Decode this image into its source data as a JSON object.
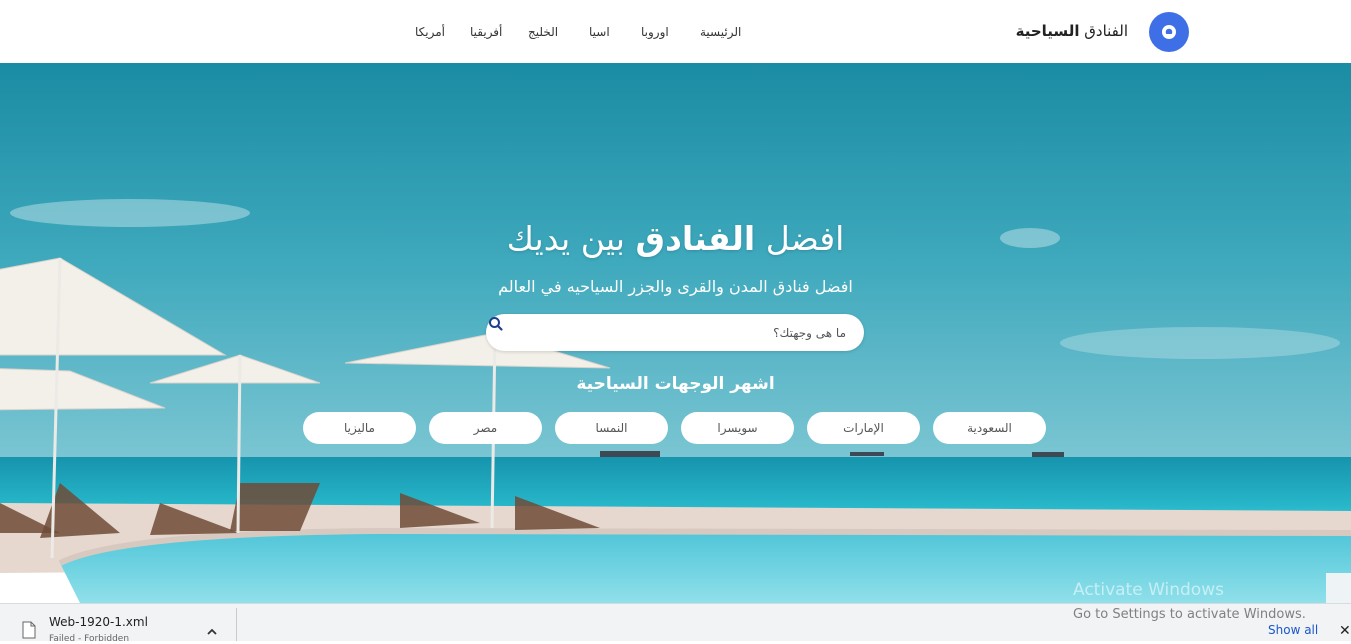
{
  "brand": {
    "title_light": "الفنادق",
    "title_bold": "السياحية",
    "logo_icon": "map-pin-icon",
    "accent_color": "#3f6fe6"
  },
  "nav": {
    "items": [
      {
        "label": "الرئيسية"
      },
      {
        "label": "اوروبا"
      },
      {
        "label": "اسيا"
      },
      {
        "label": "الخليج"
      },
      {
        "label": "أفريقيا"
      },
      {
        "label": "أمريكا"
      }
    ]
  },
  "hero": {
    "title_part1": "افضل",
    "title_part2": "الفنادق",
    "title_part3": "بين يديك",
    "subtitle": "افضل فنادق المدن والقرى والجزر السياحيه في العالم",
    "search": {
      "placeholder": "ما هى وجهتك؟",
      "value": "",
      "icon": "search-icon"
    },
    "popular_title": "اشهر الوجهات السياحية",
    "destinations": [
      {
        "label": "السعودية"
      },
      {
        "label": "الإمارات"
      },
      {
        "label": "سويسرا"
      },
      {
        "label": "النمسا"
      },
      {
        "label": "مصر"
      },
      {
        "label": "ماليزيا"
      }
    ]
  },
  "download_bar": {
    "file_name": "Web-1920-1.xml",
    "status": "Failed - Forbidden",
    "show_all_label": "Show all",
    "close_label": "✕"
  },
  "watermark": {
    "title": "Activate Windows",
    "subtitle": "Go to Settings to activate Windows."
  }
}
